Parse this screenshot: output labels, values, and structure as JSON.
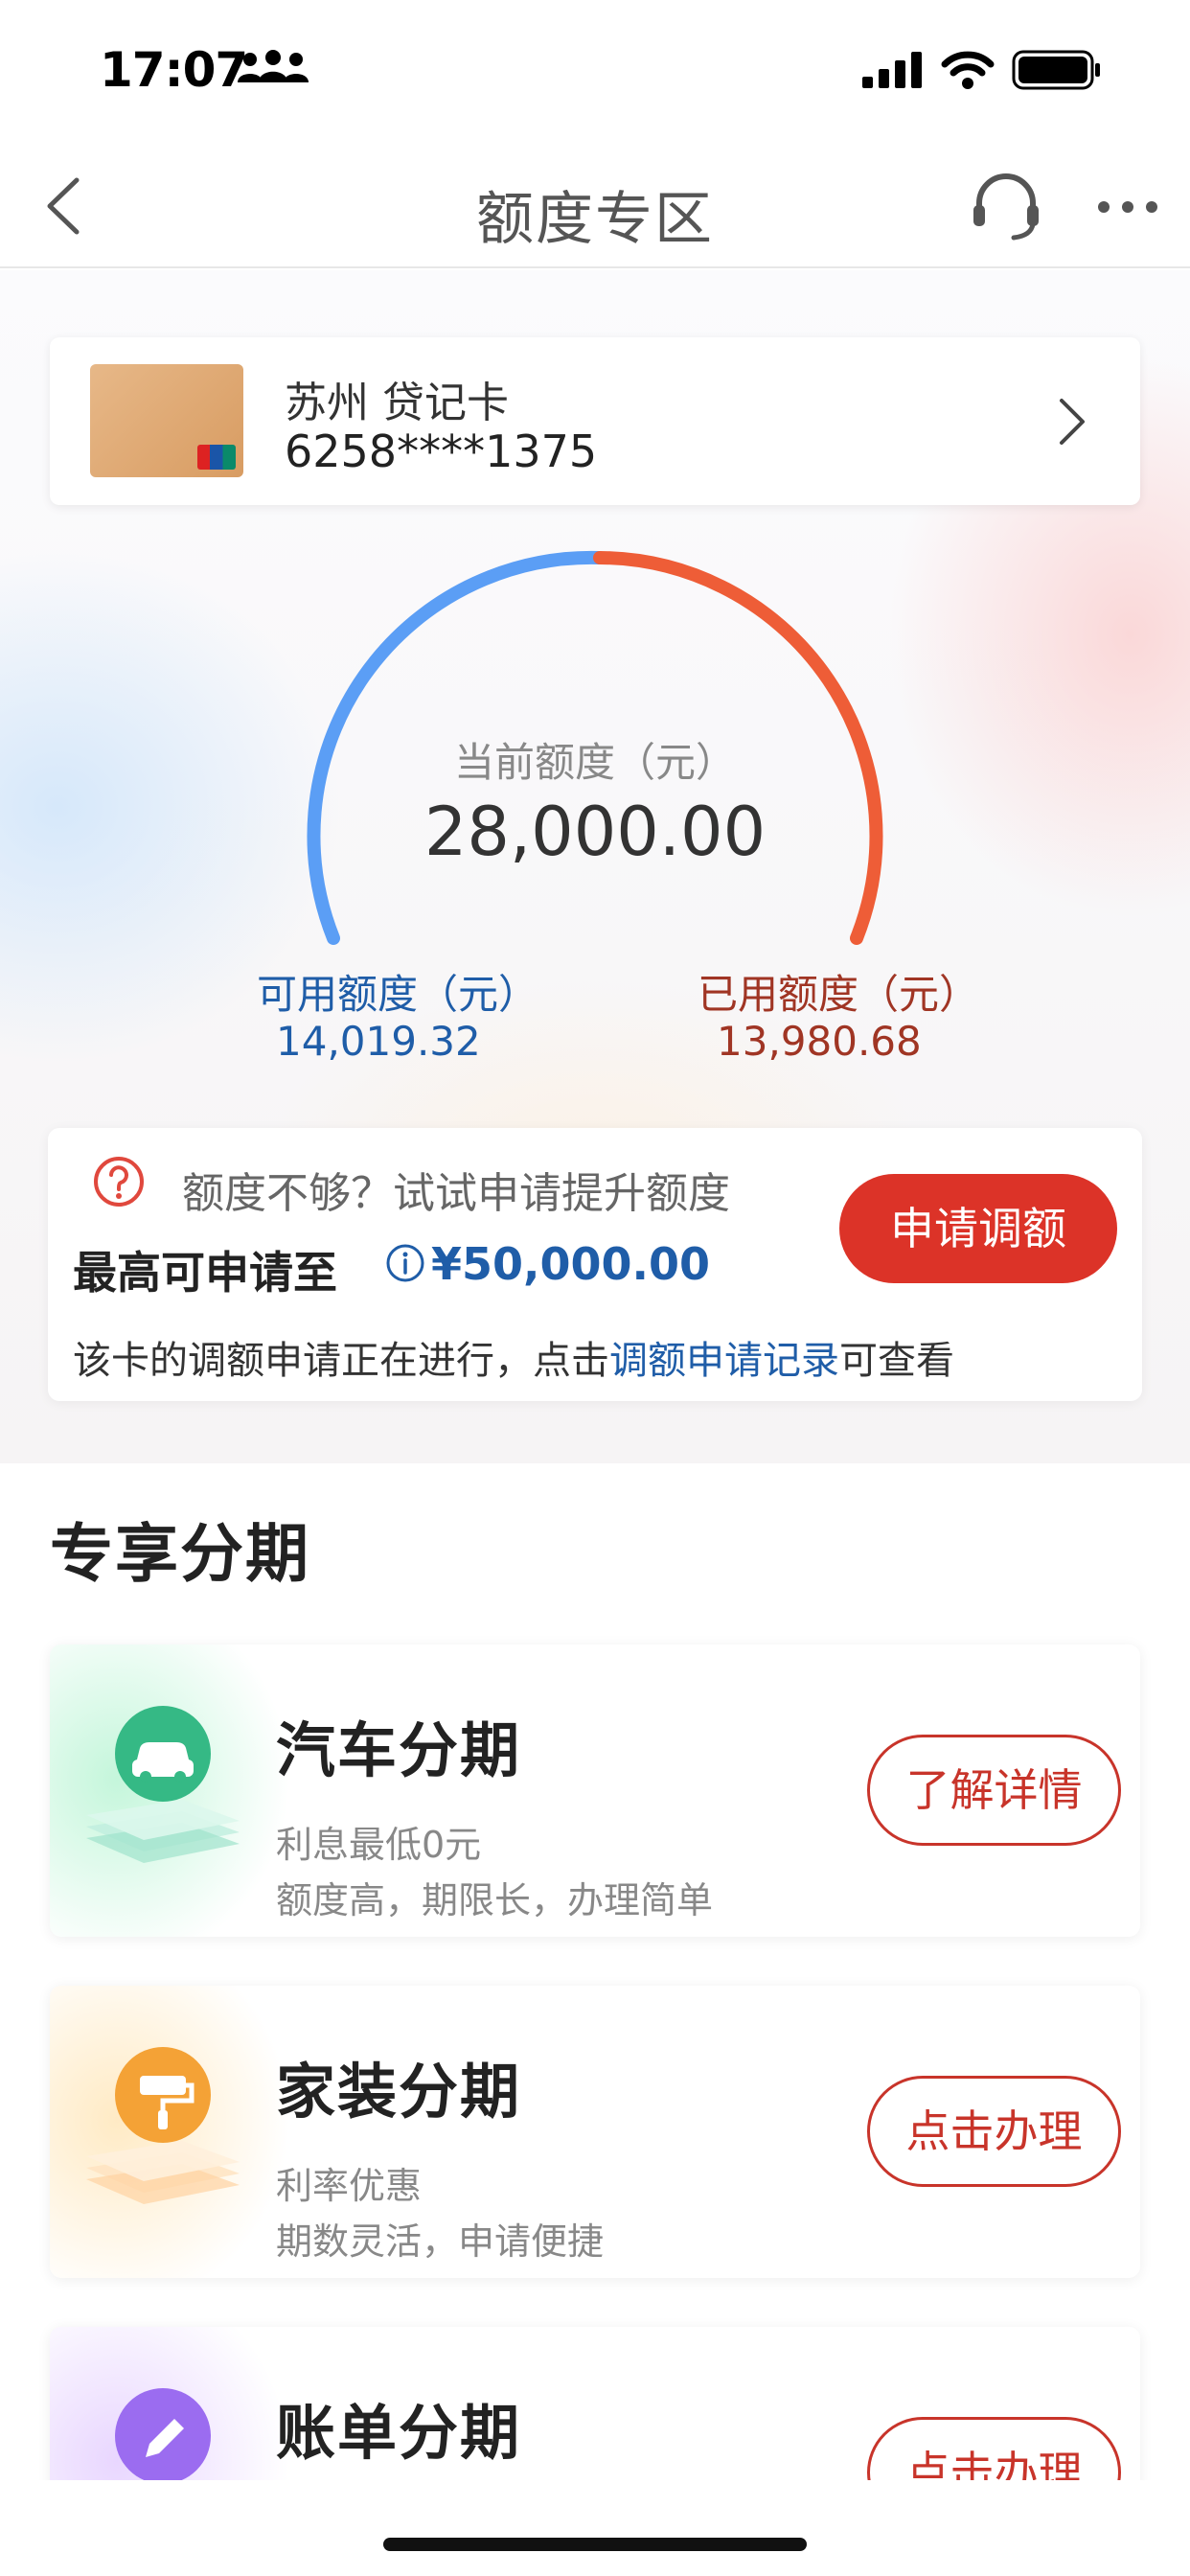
{
  "status_bar": {
    "time": "17:07"
  },
  "nav": {
    "title": "额度专区"
  },
  "card": {
    "name": "苏州 贷记卡",
    "number": "6258****1375"
  },
  "credit": {
    "current_label": "当前额度（元）",
    "current_value": "28,000.00",
    "available_label": "可用额度（元）",
    "available_value": "14,019.32",
    "used_label": "已用额度（元）",
    "used_value": "13,980.68"
  },
  "raise": {
    "hint": "额度不够？试试申请提升额度",
    "max_label": "最高可申请至",
    "max_amount": "¥50,000.00",
    "button": "申请调额",
    "note_before": "该卡的调额申请正在进行，点击",
    "note_link": "调额申请记录",
    "note_after": "可查看"
  },
  "section": {
    "title": "专享分期"
  },
  "installments": [
    {
      "title": "汽车分期",
      "sub1": "利息最低0元",
      "sub2": "额度高，期限长，办理简单",
      "button": "了解详情",
      "icon": "car-icon",
      "color": "#35b985"
    },
    {
      "title": "家装分期",
      "sub1": "利率优惠",
      "sub2": "期数灵活，申请便捷",
      "button": "点击办理",
      "icon": "paint-roller-icon",
      "color": "#f4a236"
    },
    {
      "title": "账单分期",
      "button": "点击办理",
      "icon": "pencil-icon",
      "color": "#9b6cf0"
    }
  ],
  "colors": {
    "gauge_available": "#5b9ef5",
    "gauge_used": "#ee5d37",
    "primary_red": "#dc3328",
    "link_blue": "#1f5da8"
  }
}
